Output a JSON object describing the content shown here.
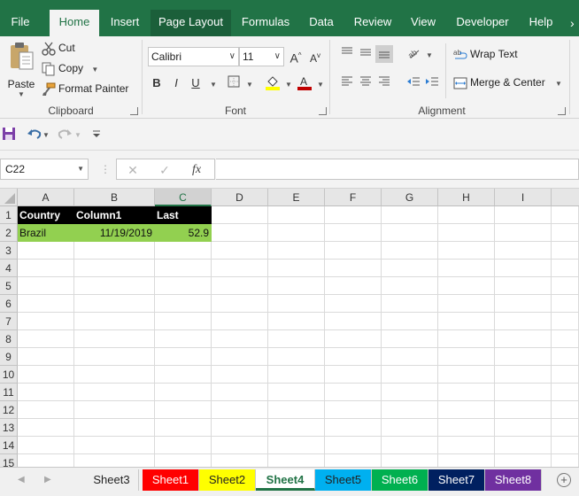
{
  "ribbon_tabs": [
    {
      "label": "File"
    },
    {
      "label": "Home"
    },
    {
      "label": "Insert"
    },
    {
      "label": "Page Layout"
    },
    {
      "label": "Formulas"
    },
    {
      "label": "Data"
    },
    {
      "label": "Review"
    },
    {
      "label": "View"
    },
    {
      "label": "Developer"
    },
    {
      "label": "Help"
    }
  ],
  "clipboard": {
    "paste": "Paste",
    "cut": "Cut",
    "copy": "Copy",
    "format_painter": "Format Painter",
    "group_label": "Clipboard"
  },
  "font": {
    "name": "Calibri",
    "size": "11",
    "bold": "B",
    "italic": "I",
    "underline": "U",
    "group_label": "Font"
  },
  "alignment": {
    "wrap_text": "Wrap Text",
    "merge_center": "Merge & Center",
    "group_label": "Alignment"
  },
  "formula_bar": {
    "name_box": "C22",
    "fx": "fx",
    "value": ""
  },
  "grid": {
    "columns": [
      "A",
      "B",
      "C",
      "D",
      "E",
      "F",
      "G",
      "H",
      "I"
    ],
    "rows": [
      "1",
      "2",
      "3",
      "4",
      "5",
      "6",
      "7",
      "8",
      "9",
      "10",
      "11",
      "12",
      "13",
      "14",
      "15"
    ],
    "selected_column": "C",
    "header_fill": "#000000",
    "data_fill": "#92D050",
    "cells": {
      "A1": "Country",
      "B1": "Column1",
      "C1": "Last",
      "A2": "Brazil",
      "B2": "11/19/2019",
      "C2": "52.9"
    }
  },
  "sheets": [
    {
      "name": "Sheet3",
      "color": "#F0F0F0",
      "text": "#222222"
    },
    {
      "name": "Sheet1",
      "color": "#FF0000",
      "text": "#FFFFFF"
    },
    {
      "name": "Sheet2",
      "color": "#FFFF00",
      "text": "#222222"
    },
    {
      "name": "Sheet4",
      "color": "#FFFFFF",
      "text": "#217346"
    },
    {
      "name": "Sheet5",
      "color": "#00B0F0",
      "text": "#222222"
    },
    {
      "name": "Sheet6",
      "color": "#00B050",
      "text": "#FFFFFF"
    },
    {
      "name": "Sheet7",
      "color": "#002060",
      "text": "#FFFFFF"
    },
    {
      "name": "Sheet8",
      "color": "#7030A0",
      "text": "#FFFFFF"
    }
  ],
  "active_sheet": "Sheet4",
  "accent": "#217346"
}
